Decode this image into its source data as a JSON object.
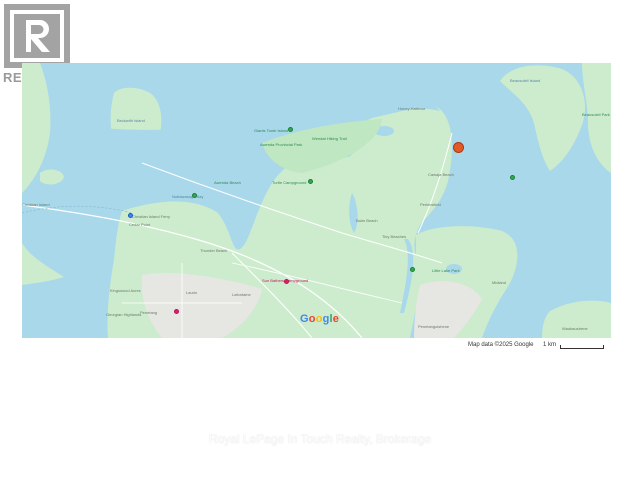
{
  "logo": {
    "text": "REALTOR®"
  },
  "map": {
    "google_label": "Google",
    "attribution": "Map data ©2025 Google",
    "scale_label": "1 km",
    "colors": {
      "water": "#a8d8ea",
      "land": "#cdeccd",
      "urban": "#e6e6e3",
      "park": "#bfe7c1",
      "marker": "#e25a26"
    },
    "place_labels": [
      {
        "text": "Beckwith Island",
        "kind": "water"
      },
      {
        "text": "Giants Tomb Island",
        "kind": "green"
      },
      {
        "text": "Awenda Provincial Park",
        "kind": "green"
      },
      {
        "text": "Wendat Hiking Trail",
        "kind": "green"
      },
      {
        "text": "Turtle Campground",
        "kind": "green"
      },
      {
        "text": "Awenda Beach",
        "kind": "green"
      },
      {
        "text": "Nottawasaga Bay",
        "kind": "water"
      },
      {
        "text": "Christian Island",
        "kind": "land"
      },
      {
        "text": "Cedar Point",
        "kind": "land"
      },
      {
        "text": "Christian Island Ferry",
        "kind": "land"
      },
      {
        "text": "Thunder Beach",
        "kind": "land"
      },
      {
        "text": "Kingswood Acres",
        "kind": "land"
      },
      {
        "text": "Georgian Highlands",
        "kind": "land"
      },
      {
        "text": "Lafontaine",
        "kind": "land"
      },
      {
        "text": "Laurin",
        "kind": "land"
      },
      {
        "text": "Penetang",
        "kind": "land"
      },
      {
        "text": "Sun Bathers Campground",
        "kind": "pink"
      },
      {
        "text": "Balm Beach",
        "kind": "land"
      },
      {
        "text": "Cawaja Beach",
        "kind": "land"
      },
      {
        "text": "Penetanguishene",
        "kind": "land"
      },
      {
        "text": "Tiny Beaches",
        "kind": "land"
      },
      {
        "text": "Beausoleil Island",
        "kind": "water"
      },
      {
        "text": "Beausoleil Park",
        "kind": "green"
      },
      {
        "text": "Honey Harbour",
        "kind": "land"
      },
      {
        "text": "Midland",
        "kind": "land"
      },
      {
        "text": "Little Lake Park",
        "kind": "green"
      },
      {
        "text": "Perkinsfield",
        "kind": "land"
      },
      {
        "text": "Waubaushene",
        "kind": "land"
      }
    ]
  },
  "footer": {
    "text": "Royal LePage In Touch Realty, Brokerage"
  }
}
